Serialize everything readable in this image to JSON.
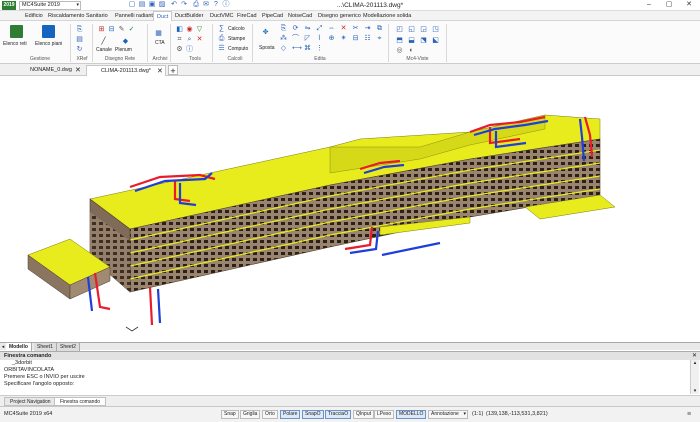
{
  "titlebar": {
    "logo": "2019",
    "suite_select": "MC4Suite 2019",
    "document_title": "...\\CLIMA-201113.dwg*",
    "quick_access_icons": [
      "new-icon",
      "open-icon",
      "save-icon",
      "save-as-icon",
      "undo-icon",
      "redo-icon",
      "print-icon",
      "email-icon",
      "help-icon",
      "info-icon"
    ]
  },
  "menu": {
    "tabs": [
      "Edificio",
      "Riscaldamento",
      "Sanitario",
      "Pannelli radianti",
      "Duct",
      "DuctBuilder",
      "DuctVMC",
      "FireCad",
      "PipeCad",
      "NoiseCad",
      "Disegno generico",
      "Modellazione solida"
    ],
    "active": "Duct"
  },
  "ribbon": {
    "groups": {
      "gestione": "Gestione",
      "xref": "XRef",
      "disegno_rete": "Disegno Rete",
      "archivi": "Archivi",
      "tools": "Tools",
      "calcoli": "Calcoli",
      "edita": "Edita",
      "mc4_viste": "Mc4-Viste"
    },
    "buttons": {
      "elenco_reti": "Elenco reti",
      "elenco_piani": "Elenco piani",
      "canale": "Canale",
      "plenum": "Plenum",
      "cta": "CTA",
      "calcolo": "Calcolo",
      "stampe": "Stampe",
      "computo": "Computo",
      "sposta": "Sposta"
    }
  },
  "doc_tabs": [
    {
      "label": "NONAME_0.dwg",
      "active": false
    },
    {
      "label": "CLIMA-201113.dwg*",
      "active": true
    }
  ],
  "layout_tabs": [
    {
      "label": "Modello",
      "active": true
    },
    {
      "label": "Sheet1",
      "active": false
    },
    {
      "label": "Sheet2",
      "active": false
    }
  ],
  "command_window": {
    "title": "Finestra comando",
    "lines": [
      "_3dorbit",
      "ORBITAVINCOLATA",
      "Premere ESC o INVIO per uscire",
      "  Specificare l'angolo opposto:"
    ]
  },
  "panel_tabs": [
    {
      "label": "Project Navigation",
      "active": false
    },
    {
      "label": "Finestra comando",
      "active": true
    }
  ],
  "statusbar": {
    "app_version": "MC4Suite 2019 x64",
    "toggles": [
      {
        "label": "Snap",
        "on": false
      },
      {
        "label": "Griglia",
        "on": false
      },
      {
        "label": "Orto",
        "on": false
      },
      {
        "label": "Polare",
        "on": true
      },
      {
        "label": "SnapO",
        "on": true
      },
      {
        "label": "TracciaO",
        "on": true
      },
      {
        "label": "QInput",
        "on": false
      },
      {
        "label": "LPeso",
        "on": false
      },
      {
        "label": "MODELLO",
        "on": true
      }
    ],
    "annotation": "Annotazione",
    "scale": "(1:1)",
    "coordinates": "(139,138,-113,531,3,821)"
  },
  "colors": {
    "slab": "#e8ec1c",
    "facade": "#a08a72",
    "duct_red": "#e81c2a",
    "duct_blue": "#1f3fd8",
    "accent": "#2b62b8"
  }
}
